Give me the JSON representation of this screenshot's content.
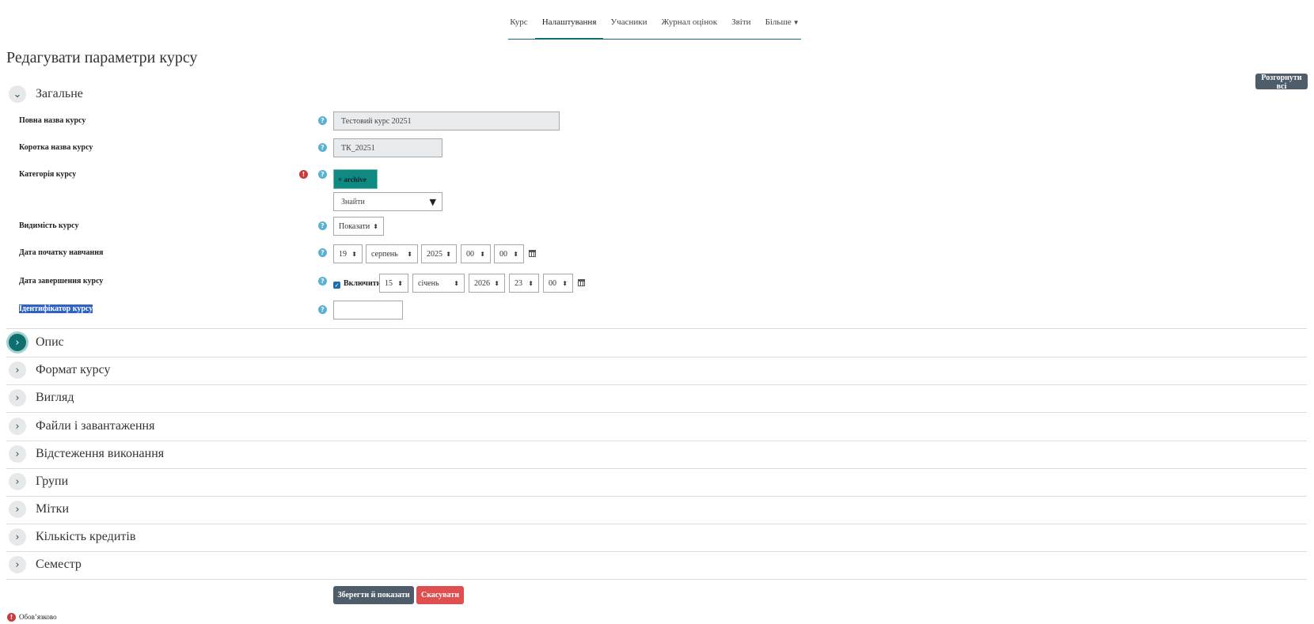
{
  "nav": {
    "items": [
      {
        "label": "Курс"
      },
      {
        "label": "Налаштування",
        "active": true
      },
      {
        "label": "Учасники"
      },
      {
        "label": "Журнал оцінок"
      },
      {
        "label": "Звіти"
      },
      {
        "label": "Більше"
      }
    ],
    "accent": "#0f6e6e"
  },
  "page_title": "Редагувати параметри курсу",
  "expand_all_label": "Розгорнути всі",
  "general": {
    "title": "Загальне",
    "full_name": {
      "label": "Повна назва курсу",
      "value": "Тестовий курс 20251"
    },
    "short_name": {
      "label": "Коротка назва курсу",
      "value": "ТК_20251"
    },
    "category": {
      "label": "Категорія курсу",
      "tag": "× archive",
      "search_placeholder": "Знайти"
    },
    "visibility": {
      "label": "Видимість курсу",
      "value": "Показати"
    },
    "start_date": {
      "label": "Дата початку навчання",
      "day": "19",
      "month": "серпень",
      "year": "2025",
      "hour": "00",
      "minute": "00"
    },
    "end_date": {
      "label": "Дата завершення курсу",
      "enable_label": "Включити",
      "enabled": true,
      "day": "15",
      "month": "січень",
      "year": "2026",
      "hour": "23",
      "minute": "00"
    },
    "id_number": {
      "label": "Ідентифікатор курсу",
      "value": ""
    }
  },
  "sections": [
    {
      "title": "Опис"
    },
    {
      "title": "Формат курсу"
    },
    {
      "title": "Вигляд"
    },
    {
      "title": "Файли і завантаження"
    },
    {
      "title": "Відстеження виконання"
    },
    {
      "title": "Групи"
    },
    {
      "title": "Мітки"
    },
    {
      "title": "Кількість кредитів"
    },
    {
      "title": "Семестр"
    }
  ],
  "buttons": {
    "save": "Зберегти й показати",
    "cancel": "Скасувати"
  },
  "required_note": "Обов’язково",
  "colors": {
    "save": "#4f5d6b",
    "cancel": "#e04f4f",
    "tag": "#0f8a80"
  }
}
